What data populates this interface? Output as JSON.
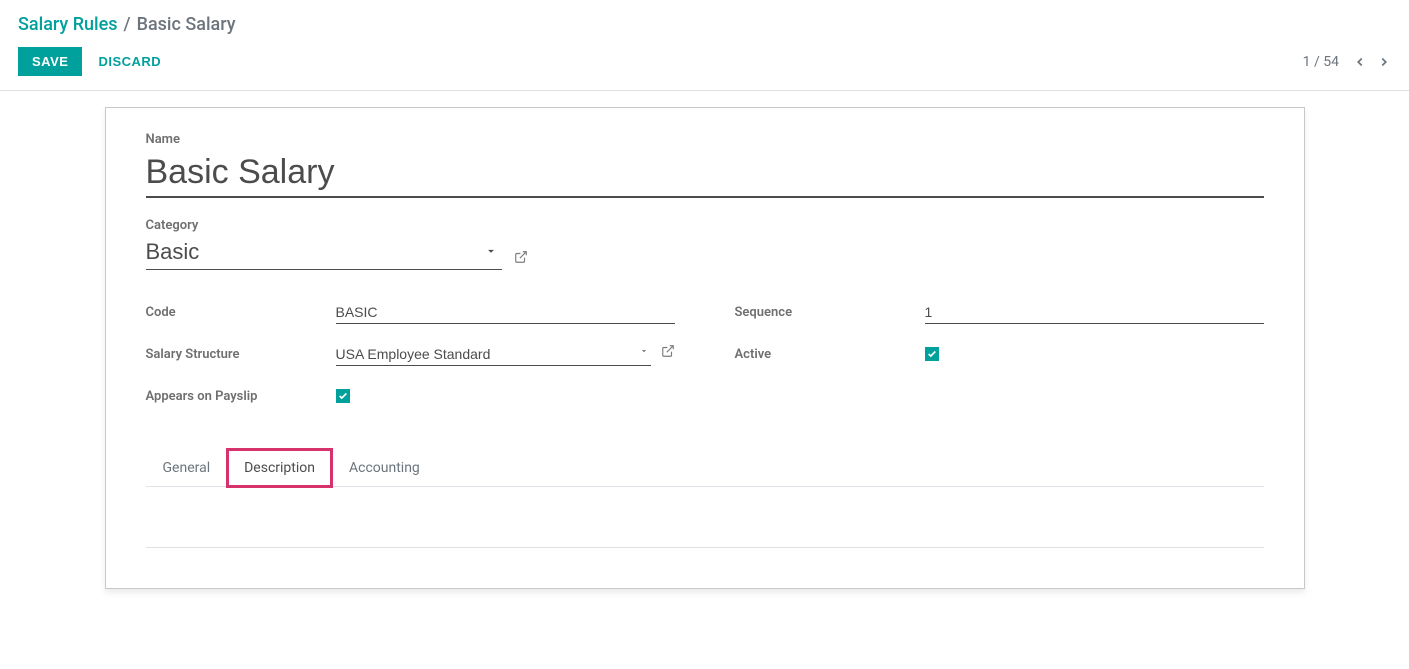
{
  "breadcrumb": {
    "root": "Salary Rules",
    "separator": "/",
    "current": "Basic Salary"
  },
  "actions": {
    "save": "Save",
    "discard": "Discard"
  },
  "pager": {
    "text": "1 / 54"
  },
  "form": {
    "name_label": "Name",
    "name_value": "Basic Salary",
    "category_label": "Category",
    "category_value": "Basic",
    "code_label": "Code",
    "code_value": "BASIC",
    "salary_structure_label": "Salary Structure",
    "salary_structure_value": "USA Employee Standard",
    "appears_on_payslip_label": "Appears on Payslip",
    "appears_on_payslip_checked": true,
    "sequence_label": "Sequence",
    "sequence_value": "1",
    "active_label": "Active",
    "active_checked": true
  },
  "tabs": [
    {
      "label": "General",
      "active": false,
      "highlight": false
    },
    {
      "label": "Description",
      "active": true,
      "highlight": true
    },
    {
      "label": "Accounting",
      "active": false,
      "highlight": false
    }
  ]
}
